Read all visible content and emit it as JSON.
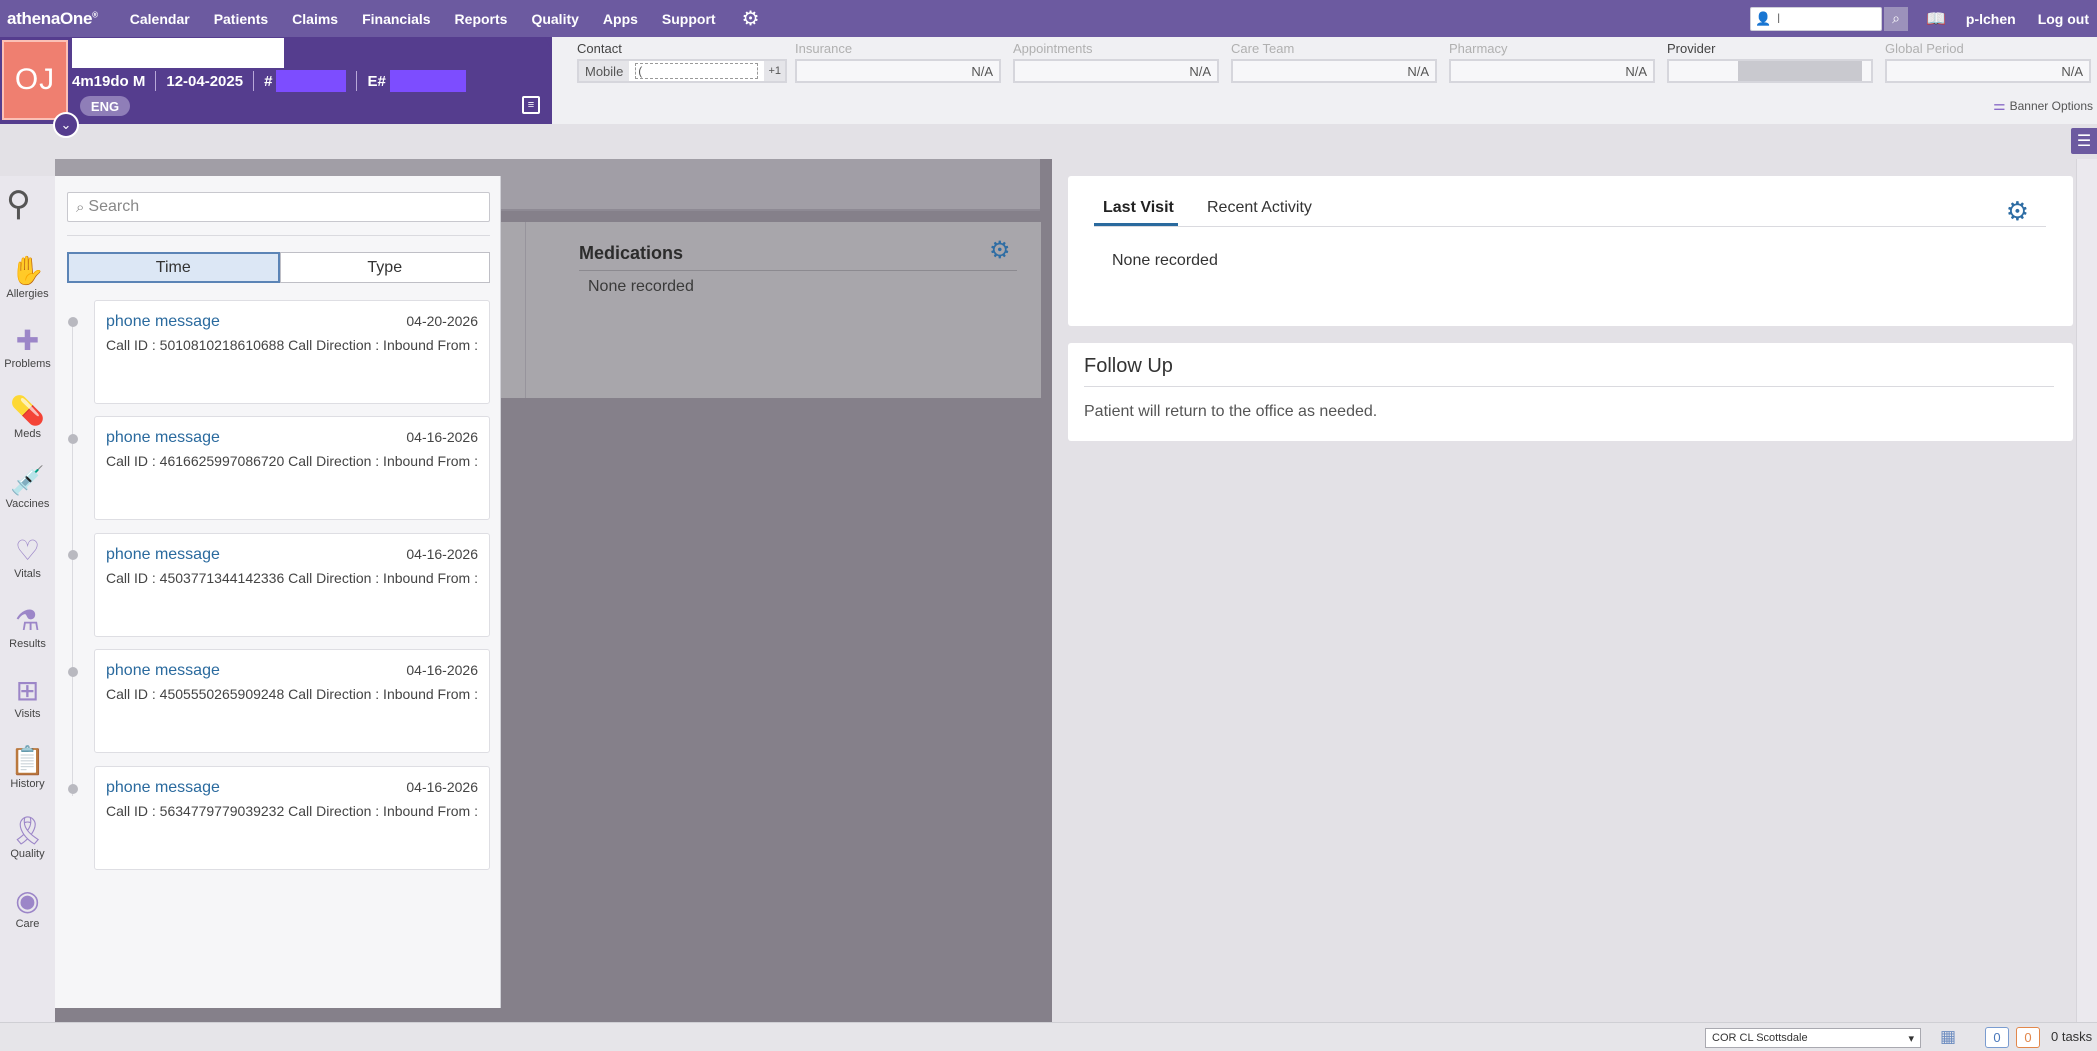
{
  "nav": {
    "logo": "athenaOne",
    "logo_mark": "®",
    "items": [
      "Calendar",
      "Patients",
      "Claims",
      "Financials",
      "Reports",
      "Quality",
      "Apps",
      "Support"
    ],
    "user_search_value": "l",
    "username": "p-lchen",
    "logout": "Log out"
  },
  "patient": {
    "initials": "OJ",
    "age_sex": "4m19do M",
    "dob": "12-04-2025",
    "id_prefix": "#",
    "enterprise_prefix": "E#",
    "language": "ENG"
  },
  "banner": {
    "contact_label": "Contact",
    "contact_type": "Mobile",
    "contact_value": "(",
    "contact_more": "+1",
    "insurance_label": "Insurance",
    "insurance_value": "N/A",
    "appointments_label": "Appointments",
    "appointments_value": "N/A",
    "careteam_label": "Care Team",
    "careteam_value": "N/A",
    "pharmacy_label": "Pharmacy",
    "pharmacy_value": "N/A",
    "provider_label": "Provider",
    "global_period_label": "Global Period",
    "global_period_value": "N/A",
    "banner_options": "Banner Options"
  },
  "rail": [
    {
      "label": "Allergies",
      "icon": "hand-icon"
    },
    {
      "label": "Problems",
      "icon": "bandage-icon"
    },
    {
      "label": "Meds",
      "icon": "pill-icon"
    },
    {
      "label": "Vaccines",
      "icon": "syringe-icon"
    },
    {
      "label": "Vitals",
      "icon": "heart-icon"
    },
    {
      "label": "Results",
      "icon": "flask-icon"
    },
    {
      "label": "Visits",
      "icon": "medkit-icon"
    },
    {
      "label": "History",
      "icon": "clipboard-icon"
    },
    {
      "label": "Quality",
      "icon": "ribbon-icon"
    },
    {
      "label": "Care",
      "icon": "care-icon"
    }
  ],
  "flyout": {
    "search_placeholder": "Search",
    "toggle_time": "Time",
    "toggle_type": "Type",
    "messages": [
      {
        "title": "phone message",
        "date": "04-20-2026",
        "body": "Call ID : 5010810218610688 Call Direction : Inbound From :"
      },
      {
        "title": "phone message",
        "date": "04-16-2026",
        "body": "Call ID : 4616625997086720 Call Direction : Inbound From :"
      },
      {
        "title": "phone message",
        "date": "04-16-2026",
        "body": "Call ID : 4503771344142336 Call Direction : Inbound From :"
      },
      {
        "title": "phone message",
        "date": "04-16-2026",
        "body": "Call ID : 4505550265909248 Call Direction : Inbound From :"
      },
      {
        "title": "phone message",
        "date": "04-16-2026",
        "body": "Call ID : 5634779779039232 Call Direction : Inbound From :"
      }
    ]
  },
  "medications": {
    "title": "Medications",
    "empty": "None recorded"
  },
  "last_visit": {
    "tab_last_visit": "Last Visit",
    "tab_recent_activity": "Recent Activity",
    "empty": "None recorded"
  },
  "follow_up": {
    "title": "Follow Up",
    "text": "Patient will return to the office as needed."
  },
  "footer": {
    "department": "COR CL Scottsdale",
    "count_blue": "0",
    "count_orange": "0",
    "tasks": "0 tasks"
  },
  "colors": {
    "nav_bg": "#6c5aa0",
    "banner_bg": "#553d8e",
    "avatar_bg": "#ef7f70",
    "link": "#2a6a9e"
  }
}
